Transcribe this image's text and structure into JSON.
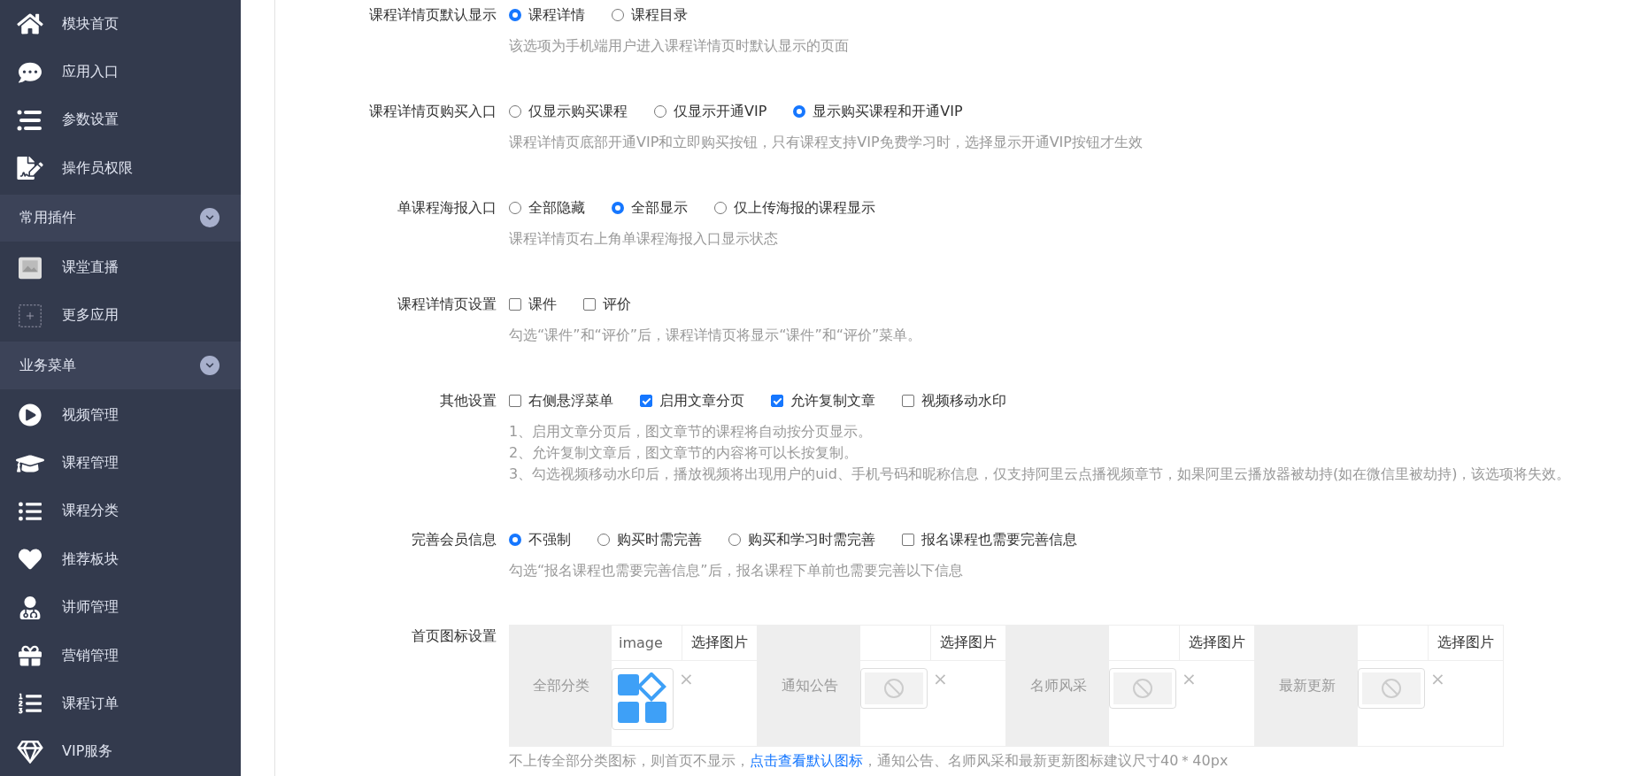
{
  "sidebar": [
    {
      "kind": "item",
      "label": "模块首页"
    },
    {
      "kind": "item",
      "label": "应用入口"
    },
    {
      "kind": "item",
      "label": "参数设置"
    },
    {
      "kind": "item",
      "label": "操作员权限"
    },
    {
      "kind": "group",
      "label": "常用插件",
      "expanded": true
    },
    {
      "kind": "item",
      "label": "课堂直播"
    },
    {
      "kind": "item",
      "label": "更多应用"
    },
    {
      "kind": "group",
      "label": "业务菜单",
      "expanded": true
    },
    {
      "kind": "item",
      "label": "视频管理"
    },
    {
      "kind": "item",
      "label": "课程管理"
    },
    {
      "kind": "item",
      "label": "课程分类"
    },
    {
      "kind": "item",
      "label": "推荐板块"
    },
    {
      "kind": "item",
      "label": "讲师管理"
    },
    {
      "kind": "item",
      "label": "营销管理"
    },
    {
      "kind": "item",
      "label": "课程订单"
    },
    {
      "kind": "item",
      "label": "VIP服务"
    }
  ],
  "form": [
    {
      "label": "课程详情页默认显示",
      "options": [
        {
          "kind": "radio",
          "label": "课程详情",
          "selected": true
        },
        {
          "kind": "radio",
          "label": "课程目录",
          "selected": false
        }
      ],
      "hints": [
        "该选项为手机端用户进入课程详情页时默认显示的页面"
      ]
    },
    {
      "label": "课程详情页购买入口",
      "options": [
        {
          "kind": "radio",
          "label": "仅显示购买课程",
          "selected": false
        },
        {
          "kind": "radio",
          "label": "仅显示开通VIP",
          "selected": false
        },
        {
          "kind": "radio",
          "label": "显示购买课程和开通VIP",
          "selected": true
        }
      ],
      "hints": [
        "课程详情页底部开通VIP和立即购买按钮，只有课程支持VIP免费学习时，选择显示开通VIP按钮才生效"
      ]
    },
    {
      "label": "单课程海报入口",
      "options": [
        {
          "kind": "radio",
          "label": "全部隐藏",
          "selected": false
        },
        {
          "kind": "radio",
          "label": "全部显示",
          "selected": true
        },
        {
          "kind": "radio",
          "label": "仅上传海报的课程显示",
          "selected": false
        }
      ],
      "hints": [
        "课程详情页右上角单课程海报入口显示状态"
      ]
    },
    {
      "label": "课程详情页设置",
      "options": [
        {
          "kind": "checkbox",
          "label": "课件",
          "checked": false
        },
        {
          "kind": "checkbox",
          "label": "评价",
          "checked": false
        }
      ],
      "hints": [
        "勾选“课件”和“评价”后，课程详情页将显示“课件”和“评价”菜单。"
      ]
    },
    {
      "label": "其他设置",
      "options": [
        {
          "kind": "checkbox",
          "label": "右侧悬浮菜单",
          "checked": false
        },
        {
          "kind": "checkbox",
          "label": "启用文章分页",
          "checked": true
        },
        {
          "kind": "checkbox",
          "label": "允许复制文章",
          "checked": true
        },
        {
          "kind": "checkbox",
          "label": "视频移动水印",
          "checked": false
        }
      ],
      "hints": [
        "1、启用文章分页后，图文章节的课程将自动按分页显示。",
        "2、允许复制文章后，图文章节的内容将可以长按复制。",
        "3、勾选视频移动水印后，播放视频将出现用户的uid、手机号码和昵称信息，仅支持阿里云点播视频章节，如果阿里云播放器被劫持(如在微信里被劫持)，该选项将失效。"
      ]
    },
    {
      "label": "完善会员信息",
      "options": [
        {
          "kind": "radio",
          "label": "不强制",
          "selected": true
        },
        {
          "kind": "radio",
          "label": "购买时需完善",
          "selected": false
        },
        {
          "kind": "radio",
          "label": "购买和学习时需完善",
          "selected": false
        },
        {
          "kind": "checkbox",
          "label": "报名课程也需要完善信息",
          "checked": false
        }
      ],
      "hints": [
        "勾选“报名课程也需要完善信息”后，报名课程下单前也需要完善以下信息"
      ]
    }
  ],
  "icon_settings": {
    "label": "首页图标设置",
    "items": [
      {
        "label": "全部分类",
        "value": "image",
        "button": "选择图片",
        "custom_image": true,
        "remove": "×"
      },
      {
        "label": "通知公告",
        "button": "选择图片",
        "custom_image": false,
        "remove": "×"
      },
      {
        "label": "名师风采",
        "button": "选择图片",
        "custom_image": false,
        "remove": "×"
      },
      {
        "label": "最新更新",
        "button": "选择图片",
        "custom_image": false,
        "remove": "×"
      }
    ],
    "note": "不上传全部分类图标，则首页不显示，",
    "note_link": "点击查看默认图标",
    "note_tail": "，通知公告、名师风采和最新更新图标建议尺寸40＊40px"
  }
}
